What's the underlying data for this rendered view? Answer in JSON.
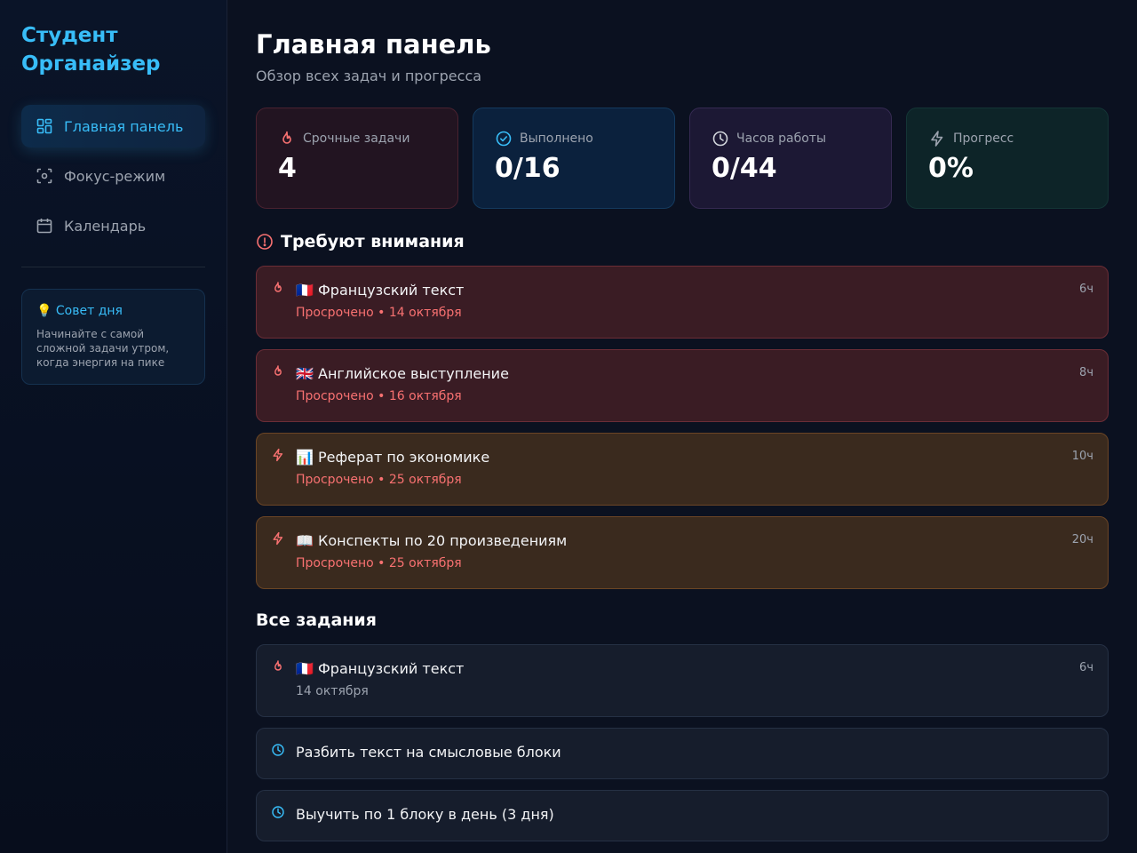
{
  "brand": {
    "title": "Студент Органайзер"
  },
  "nav": {
    "items": [
      {
        "label": "Главная панель",
        "icon": "dashboard-icon",
        "active": true
      },
      {
        "label": "Фокус-режим",
        "icon": "focus-icon",
        "active": false
      },
      {
        "label": "Календарь",
        "icon": "calendar-icon",
        "active": false
      }
    ]
  },
  "tip": {
    "title": "💡 Совет дня",
    "text": "Начинайте с самой сложной задачи утром, когда энергия на пике"
  },
  "header": {
    "title": "Главная панель",
    "subtitle": "Обзор всех задач и прогресса"
  },
  "stats": [
    {
      "label": "Срочные задачи",
      "value": "4",
      "icon": "flame-icon",
      "color": "#f87171"
    },
    {
      "label": "Выполнено",
      "value": "0/16",
      "icon": "check-circle-icon",
      "color": "#38bdf8"
    },
    {
      "label": "Часов работы",
      "value": "0/44",
      "icon": "clock-icon",
      "color": "#d1d5db"
    },
    {
      "label": "Прогресс",
      "value": "0%",
      "icon": "bolt-icon",
      "color": "#9ca3af"
    }
  ],
  "attention": {
    "title": "Требуют внимания",
    "tasks": [
      {
        "title": "🇫🇷 Французский текст",
        "sub": "Просрочено • 14 октября",
        "hours": "6ч",
        "icon": "flame-icon"
      },
      {
        "title": "🇬🇧 Английское выступление",
        "sub": "Просрочено • 16 октября",
        "hours": "8ч",
        "icon": "flame-icon"
      },
      {
        "title": "📊 Реферат по экономике",
        "sub": "Просрочено • 25 октября",
        "hours": "10ч",
        "icon": "bolt-icon"
      },
      {
        "title": "📖 Конспекты по 20 произведениям",
        "sub": "Просрочено • 25 октября",
        "hours": "20ч",
        "icon": "bolt-icon"
      }
    ]
  },
  "all": {
    "title": "Все задания",
    "tasks": [
      {
        "title": "🇫🇷 Французский текст",
        "sub": "14 октября",
        "hours": "6ч",
        "icon": "flame-icon"
      },
      {
        "title": "Разбить текст на смысловые блоки",
        "icon": "clock-icon"
      },
      {
        "title": "Выучить по 1 блоку в день (3 дня)",
        "icon": "clock-icon"
      }
    ]
  },
  "colors": {
    "accent": "#38bdf8",
    "danger": "#f87171",
    "background": "#0b1120"
  }
}
